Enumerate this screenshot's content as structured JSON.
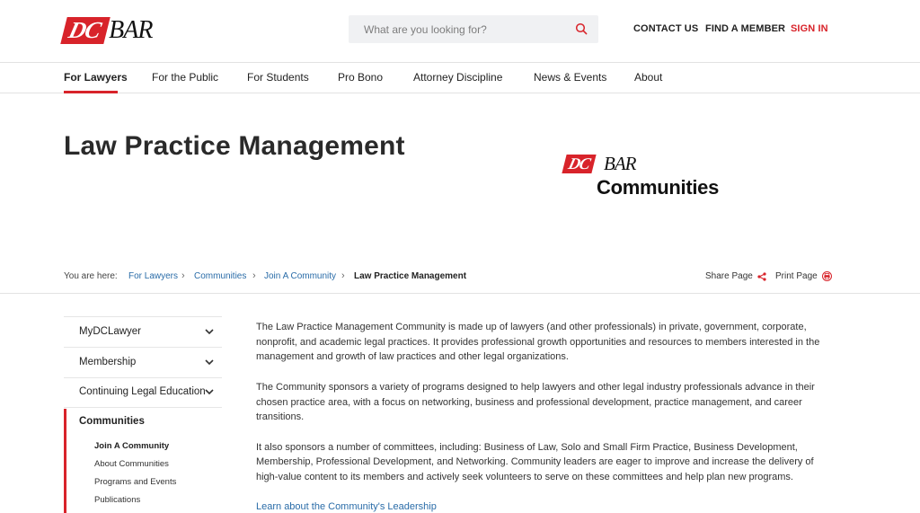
{
  "header": {
    "logo": {
      "dc": "DC",
      "bar": "BAR"
    },
    "search": {
      "placeholder": "What are you looking for?",
      "value": ""
    },
    "utility": {
      "contact": "CONTACT US",
      "find": "FIND A MEMBER",
      "sign_in": "SIGN IN"
    }
  },
  "nav": {
    "items": [
      "For Lawyers",
      "For the Public",
      "For Students",
      "Pro Bono",
      "Attorney Discipline",
      "News & Events",
      "About"
    ]
  },
  "page": {
    "title": "Law Practice Management",
    "community_logo": {
      "dc": "DC",
      "bar": "BAR",
      "word": "Communities"
    }
  },
  "breadcrumb": {
    "label": "You are here:",
    "links": [
      "For Lawyers",
      "Communities",
      "Join A Community"
    ],
    "current": "Law Practice Management",
    "share": "Share Page",
    "print": "Print Page"
  },
  "sidebar": {
    "items": [
      "MyDCLawyer",
      "Membership",
      "Continuing Legal Education",
      "Communities"
    ],
    "sub_items": [
      "Join A Community",
      "About Communities",
      "Programs and Events",
      "Publications"
    ]
  },
  "content": {
    "paragraphs": [
      "The Law Practice Management Community is made up of lawyers (and other professionals) in private, government, corporate, nonprofit, and academic legal practices. It provides professional growth opportunities and resources to members interested in the management and growth of law practices and other legal organizations.",
      "The Community sponsors a variety of programs designed to help lawyers and other legal industry professionals advance in their chosen practice area, with a focus on networking, business and professional development, practice management, and career transitions.",
      "It also sponsors a number of committees, including: Business of Law, Solo and Small Firm Practice, Business Development, Membership, Professional Development, and Networking. Community leaders are eager to improve and increase the delivery of high-value content to its members and actively seek volunteers to serve on these committees and help plan new programs."
    ],
    "leadership_link": "Learn about the Community's Leadership"
  },
  "colors": {
    "brand_red": "#d8232a",
    "link_blue": "#2a6ca8"
  }
}
